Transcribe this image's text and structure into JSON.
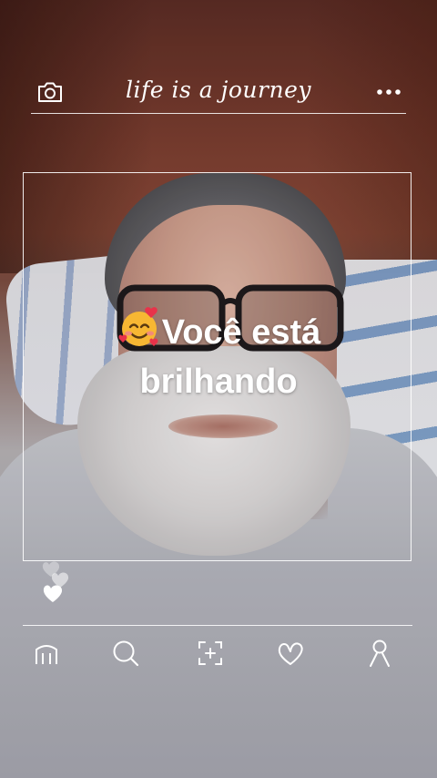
{
  "header": {
    "title": "life is a journey",
    "left_icon": "camera-icon",
    "right_icon": "more-dots-icon"
  },
  "caption": {
    "emoji": "smiling-face-with-hearts",
    "text_line1": "Você está",
    "text_line2": "brilhando"
  },
  "reactions": {
    "icon": "hearts-icon"
  },
  "nav": {
    "items": [
      {
        "icon": "home-icon"
      },
      {
        "icon": "search-icon"
      },
      {
        "icon": "add-post-icon"
      },
      {
        "icon": "heart-icon"
      },
      {
        "icon": "profile-icon"
      }
    ]
  },
  "colors": {
    "overlay": "#ffffff",
    "emoji_face": "#f7b733",
    "emoji_hearts": "#e8334a"
  }
}
